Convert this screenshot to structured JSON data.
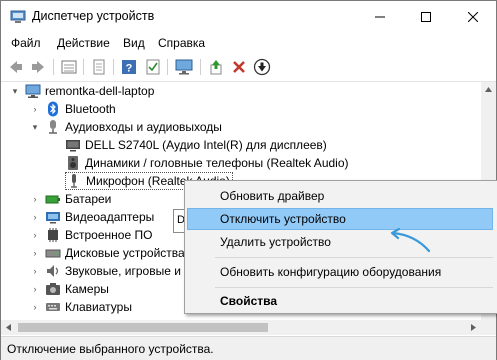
{
  "window": {
    "title": "Диспетчер устройств",
    "controls": {
      "minimize": "—",
      "maximize": "☐",
      "close": "✕"
    }
  },
  "menubar": {
    "items": [
      "Файл",
      "Действие",
      "Вид",
      "Справка"
    ]
  },
  "toolbar": {
    "buttons": [
      "back-icon",
      "forward-icon",
      "show-hide-icon",
      "properties-icon",
      "help-icon",
      "action-icon",
      "monitor-icon",
      "update-driver-icon",
      "disable-icon",
      "uninstall-icon"
    ]
  },
  "tree": {
    "root": "remontka-dell-laptop",
    "items": [
      {
        "label": "Bluetooth",
        "icon": "bluetooth-icon"
      },
      {
        "label": "Аудиовходы и аудиовыходы",
        "icon": "audio-icon"
      },
      {
        "label": "DELL S2740L (Аудио Intel(R) для дисплеев)",
        "icon": "display-audio-icon"
      },
      {
        "label": "Динамики / головные телефоны (Realtek Audio)",
        "icon": "speaker-icon"
      },
      {
        "label": "Микрофон (Realtek Audio)",
        "icon": "microphone-icon"
      },
      {
        "label": "Батареи",
        "icon": "battery-icon"
      },
      {
        "label": "Видеоадаптеры",
        "icon": "display-adapter-icon"
      },
      {
        "label": "Встроенное ПО",
        "icon": "firmware-icon"
      },
      {
        "label": "Дисковые устройства",
        "icon": "disk-icon"
      },
      {
        "label": "Звуковые, игровые и видеоустройства",
        "icon": "sound-icon"
      },
      {
        "label": "Камеры",
        "icon": "camera-icon"
      },
      {
        "label": "Клавиатуры",
        "icon": "keyboard-icon"
      }
    ]
  },
  "partial_text": "D",
  "status": {
    "text": "Отключение выбранного устройства."
  },
  "context_menu": {
    "items": [
      {
        "label": "Обновить драйвер"
      },
      {
        "label": "Отключить устройство"
      },
      {
        "label": "Удалить устройство"
      },
      {
        "label": "Обновить конфигурацию оборудования"
      },
      {
        "label": "Свойства"
      }
    ]
  },
  "colors": {
    "highlight": "#91c9f7",
    "arrow": "#3a9ad9"
  }
}
